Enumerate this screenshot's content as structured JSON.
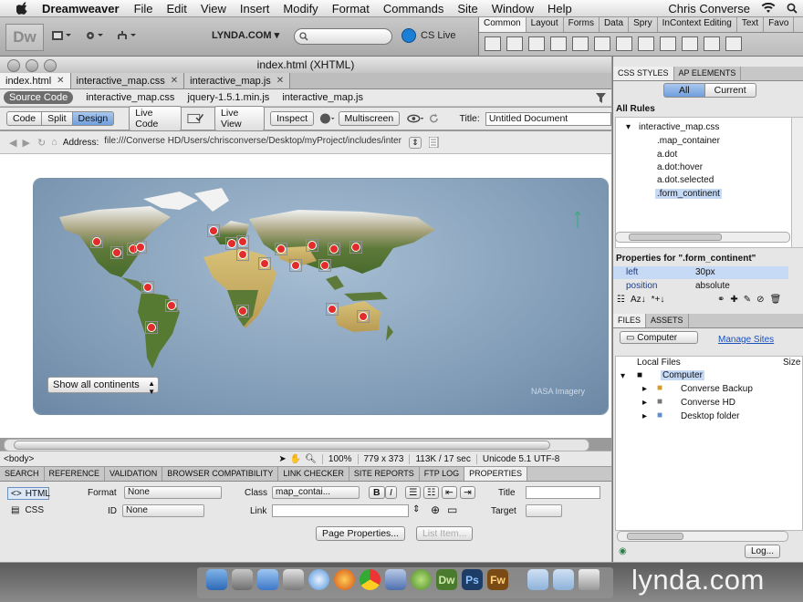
{
  "menubar": {
    "app_name": "Dreamweaver",
    "menus": [
      "File",
      "Edit",
      "View",
      "Insert",
      "Modify",
      "Format",
      "Commands",
      "Site",
      "Window",
      "Help"
    ],
    "user": "Chris Converse"
  },
  "app_toolbar": {
    "logo": "Dw",
    "lynda_label": "LYNDA.COM ▾",
    "cslive_label": "CS Live"
  },
  "insert_panel": {
    "tabs": [
      "Common",
      "Layout",
      "Forms",
      "Data",
      "Spry",
      "InContext Editing",
      "Text",
      "Favo"
    ]
  },
  "document": {
    "window_title": "index.html (XHTML)",
    "tabs": [
      {
        "label": "index.html"
      },
      {
        "label": "interactive_map.css"
      },
      {
        "label": "interactive_map.js"
      }
    ],
    "related_files": {
      "source": "Source Code",
      "files": [
        "interactive_map.css",
        "jquery-1.5.1.min.js",
        "interactive_map.js"
      ]
    },
    "view_buttons": {
      "code": "Code",
      "split": "Split",
      "design": "Design"
    },
    "live_code": "Live Code",
    "live_view": "Live View",
    "inspect": "Inspect",
    "multiscreen": "Multiscreen",
    "title_label": "Title:",
    "title_value": "Untitled Document",
    "address_label": "Address:",
    "address_value": "file:///Converse HD/Users/chrisconverse/Desktop/myProject/includes/inter"
  },
  "map": {
    "select_value": "Show all continents",
    "credit": "NASA Imagery"
  },
  "status_bar": {
    "tag": "<body>",
    "zoom": "100%",
    "dimensions": "779 x 373",
    "size": "113K / 17 sec",
    "encoding": "Unicode 5.1 UTF-8"
  },
  "bottom_tabs": [
    "SEARCH",
    "REFERENCE",
    "VALIDATION",
    "BROWSER COMPATIBILITY",
    "LINK CHECKER",
    "SITE REPORTS",
    "FTP LOG",
    "PROPERTIES"
  ],
  "properties": {
    "html_label": "HTML",
    "css_label": "CSS",
    "format_label": "Format",
    "format_value": "None",
    "class_label": "Class",
    "class_value": "map_contai...",
    "id_label": "ID",
    "id_value": "None",
    "link_label": "Link",
    "title_label": "Title",
    "target_label": "Target",
    "bold": "B",
    "italic": "I",
    "page_properties": "Page Properties...",
    "list_item": "List Item..."
  },
  "css_panel": {
    "tabs": [
      "CSS STYLES",
      "AP ELEMENTS"
    ],
    "all": "All",
    "current": "Current",
    "all_rules_label": "All Rules",
    "stylesheet": "interactive_map.css",
    "rules": [
      ".map_container",
      "a.dot",
      "a.dot:hover",
      "a.dot.selected",
      ".form_continent"
    ],
    "properties_title": "Properties for \".form_continent\"",
    "props": [
      {
        "name": "left",
        "value": "30px"
      },
      {
        "name": "position",
        "value": "absolute"
      }
    ]
  },
  "files_panel": {
    "tabs": [
      "FILES",
      "ASSETS"
    ],
    "location": "Computer",
    "manage_sites": "Manage Sites",
    "col_local": "Local Files",
    "col_size": "Size",
    "root": "Computer",
    "items": [
      "Converse Backup",
      "Converse HD",
      "Desktop folder"
    ],
    "log_button": "Log..."
  },
  "watermark": "lynda.com",
  "colors": {
    "accent": "#6f9fdc",
    "dot": "#e22b2b"
  }
}
